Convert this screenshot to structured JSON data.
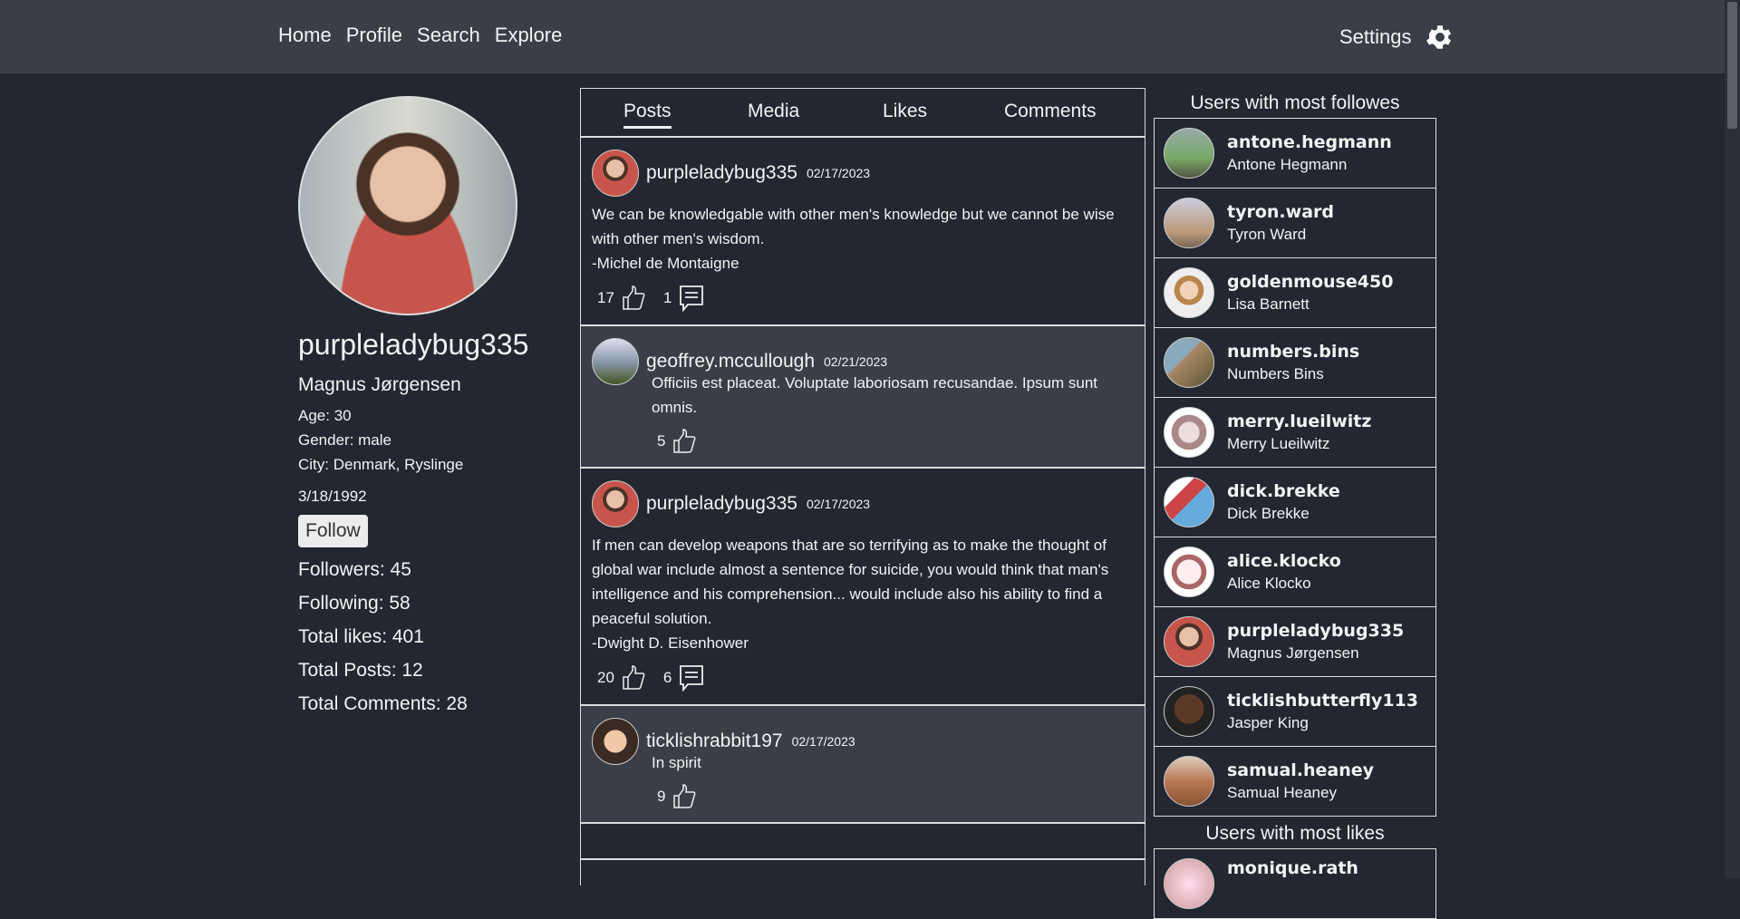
{
  "nav": {
    "links": [
      "Home",
      "Profile",
      "Search",
      "Explore"
    ],
    "settings": "Settings",
    "settings_icon": "gear-icon"
  },
  "profile": {
    "username": "purpleladybug335",
    "name": "Magnus Jørgensen",
    "age": "Age: 30",
    "gender": "Gender: male",
    "city": "City: Denmark, Ryslinge",
    "dob": "3/18/1992",
    "follow": "Follow",
    "followers": "Followers: 45",
    "following": "Following: 58",
    "total_likes": "Total likes: 401",
    "total_posts": "Total Posts: 12",
    "total_comments": "Total Comments: 28"
  },
  "tabs": [
    "Posts",
    "Media",
    "Likes",
    "Comments"
  ],
  "active_tab": "Posts",
  "posts": [
    {
      "user": "purpleladybug335",
      "date": "02/17/2023",
      "lines": [
        "We can be knowledgable with other men's knowledge but we cannot be wise with other men's wisdom.",
        "-Michel de Montaigne"
      ],
      "likes": "17",
      "comments": "1"
    },
    {
      "user": "geoffrey.mccullough",
      "date": "02/21/2023",
      "lines": [
        "Officiis est placeat. Voluptate laboriosam recusandae. Ipsum sunt omnis."
      ],
      "likes": "5"
    },
    {
      "user": "purpleladybug335",
      "date": "02/17/2023",
      "lines": [
        "If men can develop weapons that are so terrifying as to make the thought of global war include almost a sentence for suicide, you would think that man's intelligence and his comprehension... would include also his ability to find a peaceful solution.",
        "-Dwight D. Eisenhower"
      ],
      "likes": "20",
      "comments": "6"
    },
    {
      "user": "ticklishrabbit197",
      "date": "02/17/2023",
      "lines": [
        "In spirit"
      ],
      "likes": "9"
    }
  ],
  "sidebar": {
    "followers_title": "Users with most followes",
    "followers": [
      {
        "handle": "antone.hegmann",
        "name": "Antone Hegmann"
      },
      {
        "handle": "tyron.ward",
        "name": "Tyron Ward"
      },
      {
        "handle": "goldenmouse450",
        "name": "Lisa Barnett"
      },
      {
        "handle": "numbers.bins",
        "name": "Numbers Bins"
      },
      {
        "handle": "merry.lueilwitz",
        "name": "Merry Lueilwitz"
      },
      {
        "handle": "dick.brekke",
        "name": "Dick Brekke"
      },
      {
        "handle": "alice.klocko",
        "name": "Alice Klocko"
      },
      {
        "handle": "purpleladybug335",
        "name": "Magnus Jørgensen"
      },
      {
        "handle": "ticklishbutterfly113",
        "name": "Jasper King"
      },
      {
        "handle": "samual.heaney",
        "name": "Samual Heaney"
      }
    ],
    "likes_title": "Users with most likes",
    "likes": [
      {
        "handle": "monique.rath"
      }
    ]
  }
}
